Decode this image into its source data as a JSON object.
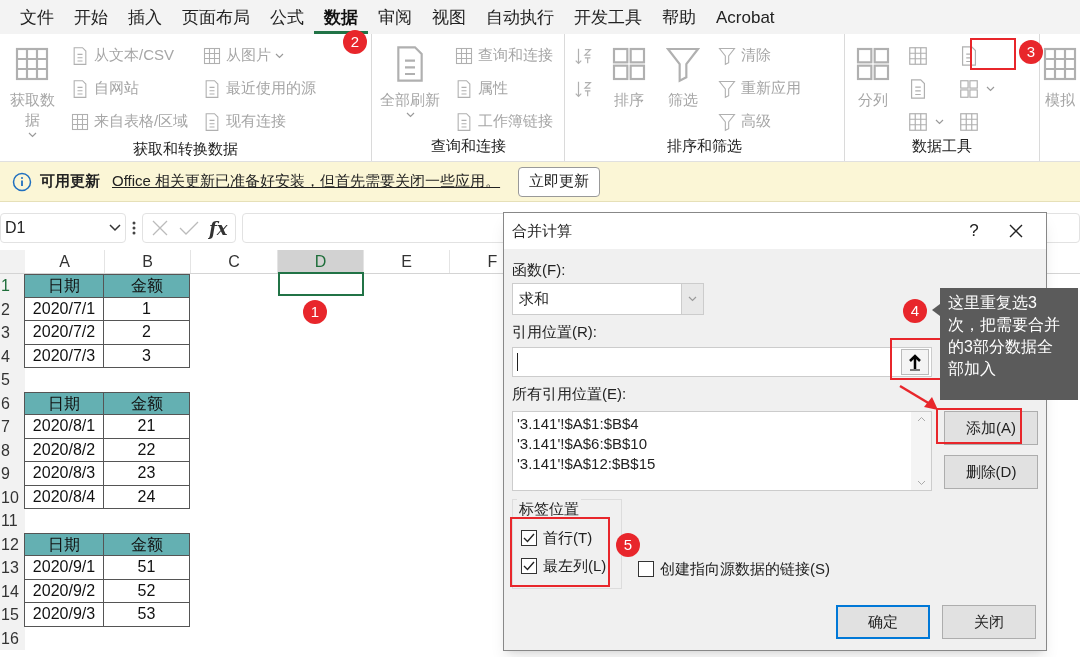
{
  "menu_tabs": [
    {
      "label": "文件",
      "selected": false
    },
    {
      "label": "开始",
      "selected": false
    },
    {
      "label": "插入",
      "selected": false
    },
    {
      "label": "页面布局",
      "selected": false
    },
    {
      "label": "公式",
      "selected": false
    },
    {
      "label": "数据",
      "selected": true
    },
    {
      "label": "审阅",
      "selected": false
    },
    {
      "label": "视图",
      "selected": false
    },
    {
      "label": "自动执行",
      "selected": false
    },
    {
      "label": "开发工具",
      "selected": false
    },
    {
      "label": "帮助",
      "selected": false
    },
    {
      "label": "Acrobat",
      "selected": false
    }
  ],
  "ribbon": {
    "disabled": true,
    "groups": [
      {
        "label": "获取和转换数据",
        "columns": [
          [
            {
              "kind": "large",
              "label": "获取数据",
              "dropdown": true
            }
          ],
          [
            {
              "kind": "small",
              "label": "从文本/CSV"
            },
            {
              "kind": "small",
              "label": "自网站"
            },
            {
              "kind": "small",
              "label": "来自表格/区域"
            }
          ],
          [
            {
              "kind": "small",
              "label": "从图片",
              "dropdown": true
            },
            {
              "kind": "small",
              "label": "最近使用的源"
            },
            {
              "kind": "small",
              "label": "现有连接"
            }
          ]
        ]
      },
      {
        "label": "查询和连接",
        "columns": [
          [
            {
              "kind": "large",
              "label": "全部刷新",
              "dropdown": true
            }
          ],
          [
            {
              "kind": "small",
              "label": "查询和连接"
            },
            {
              "kind": "small",
              "label": "属性"
            },
            {
              "kind": "small",
              "label": "工作簿链接"
            }
          ]
        ]
      },
      {
        "label": "排序和筛选",
        "columns": [
          [
            {
              "kind": "icon"
            },
            {
              "kind": "icon"
            }
          ],
          [
            {
              "kind": "large",
              "label": "排序"
            }
          ],
          [
            {
              "kind": "large",
              "label": "筛选"
            }
          ],
          [
            {
              "kind": "small",
              "label": "清除"
            },
            {
              "kind": "small",
              "label": "重新应用"
            },
            {
              "kind": "small",
              "label": "高级"
            }
          ]
        ]
      },
      {
        "label": "数据工具",
        "columns": [
          [
            {
              "kind": "large",
              "label": "分列"
            }
          ],
          [
            {
              "kind": "icon"
            },
            {
              "kind": "icon"
            },
            {
              "kind": "icon",
              "dropdown": true
            }
          ],
          [
            {
              "kind": "icon"
            },
            {
              "kind": "icon",
              "dropdown": true
            },
            {
              "kind": "icon"
            }
          ]
        ]
      },
      {
        "columns": [
          [
            {
              "kind": "large",
              "label": "模拟"
            }
          ]
        ]
      }
    ]
  },
  "update_bar": {
    "title": "可用更新",
    "message": "Office 相关更新已准备好安装，但首先需要关闭一些应用。",
    "button": "立即更新"
  },
  "formula_bar": {
    "name_box": "D1",
    "fx": "fx"
  },
  "sheet": {
    "columns": [
      {
        "label": "A",
        "selected": false
      },
      {
        "label": "B",
        "selected": false
      },
      {
        "label": "C",
        "selected": false
      },
      {
        "label": "D",
        "selected": true
      },
      {
        "label": "E",
        "selected": false
      },
      {
        "label": "F",
        "selected": false
      }
    ],
    "rows": [
      {
        "number": "1",
        "cells": [
          {
            "kind": "header",
            "text": "日期"
          },
          {
            "kind": "header",
            "text": "金额"
          }
        ]
      },
      {
        "number": "2",
        "cells": [
          {
            "kind": "data",
            "text": "2020/7/1"
          },
          {
            "kind": "data",
            "text": "1"
          }
        ]
      },
      {
        "number": "3",
        "cells": [
          {
            "kind": "data",
            "text": "2020/7/2"
          },
          {
            "kind": "data",
            "text": "2"
          }
        ]
      },
      {
        "number": "4",
        "cells": [
          {
            "kind": "data",
            "text": "2020/7/3"
          },
          {
            "kind": "data",
            "text": "3"
          }
        ]
      },
      {
        "number": "5"
      },
      {
        "number": "6",
        "cells": [
          {
            "kind": "header",
            "text": "日期"
          },
          {
            "kind": "header",
            "text": "金额"
          }
        ]
      },
      {
        "number": "7",
        "cells": [
          {
            "kind": "data",
            "text": "2020/8/1"
          },
          {
            "kind": "data",
            "text": "21"
          }
        ]
      },
      {
        "number": "8",
        "cells": [
          {
            "kind": "data",
            "text": "2020/8/2"
          },
          {
            "kind": "data",
            "text": "22"
          }
        ]
      },
      {
        "number": "9",
        "cells": [
          {
            "kind": "data",
            "text": "2020/8/3"
          },
          {
            "kind": "data",
            "text": "23"
          }
        ]
      },
      {
        "number": "10",
        "cells": [
          {
            "kind": "data",
            "text": "2020/8/4"
          },
          {
            "kind": "data",
            "text": "24"
          }
        ]
      },
      {
        "number": "11"
      },
      {
        "number": "12",
        "cells": [
          {
            "kind": "header",
            "text": "日期"
          },
          {
            "kind": "header",
            "text": "金额"
          }
        ]
      },
      {
        "number": "13",
        "cells": [
          {
            "kind": "data",
            "text": "2020/9/1"
          },
          {
            "kind": "data",
            "text": "51"
          }
        ]
      },
      {
        "number": "14",
        "cells": [
          {
            "kind": "data",
            "text": "2020/9/2"
          },
          {
            "kind": "data",
            "text": "52"
          }
        ]
      },
      {
        "number": "15",
        "cells": [
          {
            "kind": "data",
            "text": "2020/9/3"
          },
          {
            "kind": "data",
            "text": "53"
          }
        ]
      },
      {
        "number": "16"
      }
    ]
  },
  "dialog": {
    "title": "合并计算",
    "help": "?",
    "function_label": "函数(F):",
    "function_value": "求和",
    "reference_label": "引用位置(R):",
    "all_references_label": "所有引用位置(E):",
    "all_references": [
      "'3.141'!$A$1:$B$4",
      "'3.141'!$A$6:$B$10",
      "'3.141'!$A$12:$B$15"
    ],
    "add_button": "添加(A)",
    "delete_button": "删除(D)",
    "labels_group": "标签位置",
    "checkboxes": [
      {
        "label": "首行(T)",
        "checked": true
      },
      {
        "label": "最左列(L)",
        "checked": true
      },
      {
        "label": "创建指向源数据的链接(S)",
        "checked": false
      }
    ],
    "ok_button": "确定",
    "close_button": "关闭"
  },
  "annotations": {
    "badges": [
      "1",
      "2",
      "3",
      "4",
      "5"
    ],
    "tooltip": "这里重复选3次，把需要合并的3部分数据全部加入"
  }
}
